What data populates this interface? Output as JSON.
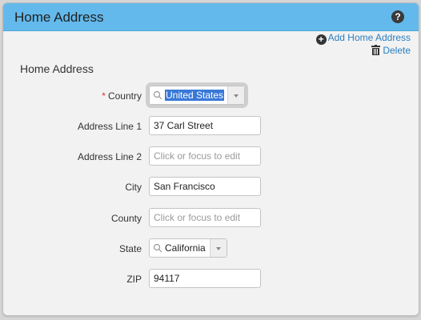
{
  "header": {
    "title": "Home Address",
    "help_glyph": "?"
  },
  "actions": {
    "add_label": "Add Home Address",
    "delete_label": "Delete"
  },
  "section": {
    "title": "Home Address"
  },
  "form": {
    "country": {
      "label": "Country",
      "required_mark": "*",
      "value": "United States"
    },
    "address1": {
      "label": "Address Line 1",
      "value": "37 Carl Street"
    },
    "address2": {
      "label": "Address Line 2",
      "placeholder": "Click or focus to edit"
    },
    "city": {
      "label": "City",
      "value": "San Francisco"
    },
    "county": {
      "label": "County",
      "placeholder": "Click or focus to edit"
    },
    "state": {
      "label": "State",
      "value": "California"
    },
    "zip": {
      "label": "ZIP",
      "value": "94117"
    }
  },
  "colors": {
    "header_bg": "#63b9eb",
    "link": "#2a7fc0",
    "required": "#d9392b",
    "selection": "#3878d8"
  },
  "icons": {
    "help": "help-icon",
    "add": "plus-circle-icon",
    "delete": "trash-icon",
    "search": "search-icon",
    "dropdown": "chevron-down-icon"
  }
}
